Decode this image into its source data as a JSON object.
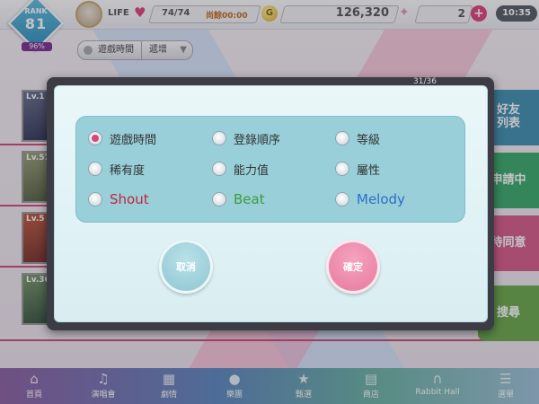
{
  "status_bar": {
    "rank_label": "RANK",
    "rank_value": "81",
    "rank_percent": "96%",
    "life_label": "LIFE",
    "life_value": "74/74",
    "life_timer": "尚餘00:00",
    "coin_symbol": "G",
    "coins": "126,320",
    "gems": "2",
    "time": "10:35"
  },
  "sort_bar": {
    "sort_label": "遊戲時間",
    "order_label": "遞增"
  },
  "list": {
    "page_indicator": "31/36",
    "cards": [
      {
        "level": "Lv.1"
      },
      {
        "level": "Lv.57"
      },
      {
        "level": "Lv.5"
      },
      {
        "level": "Lv.36"
      }
    ]
  },
  "side_buttons": [
    {
      "label": "好友\n列表"
    },
    {
      "label": "申請中"
    },
    {
      "label": "待同意"
    },
    {
      "label": "搜尋"
    }
  ],
  "bottom_nav": [
    {
      "label": "首頁",
      "icon": "home-icon"
    },
    {
      "label": "演唱會",
      "icon": "music-note-icon"
    },
    {
      "label": "劇情",
      "icon": "book-icon"
    },
    {
      "label": "樂團",
      "icon": "character-icon"
    },
    {
      "label": "甄選",
      "icon": "star-card-icon"
    },
    {
      "label": "商店",
      "icon": "shop-icon"
    },
    {
      "label": "Rabbit Hall",
      "icon": "gate-icon"
    },
    {
      "label": "選單",
      "icon": "menu-icon"
    }
  ],
  "sort_dialog": {
    "options": [
      {
        "label": "遊戲時間",
        "selected": true
      },
      {
        "label": "登錄順序",
        "selected": false
      },
      {
        "label": "等級",
        "selected": false
      },
      {
        "label": "稀有度",
        "selected": false
      },
      {
        "label": "能力值",
        "selected": false
      },
      {
        "label": "屬性",
        "selected": false
      },
      {
        "label": "Shout",
        "selected": false
      },
      {
        "label": "Beat",
        "selected": false
      },
      {
        "label": "Melody",
        "selected": false
      }
    ],
    "cancel_label": "取消",
    "confirm_label": "確定"
  },
  "colors": {
    "selected_radio": "#d8467c",
    "shout": "#c4253d",
    "beat": "#3f9a3a",
    "melody": "#2f6dc4",
    "cancel_button": "#8ec6d2",
    "confirm_button": "#e77aa0"
  }
}
